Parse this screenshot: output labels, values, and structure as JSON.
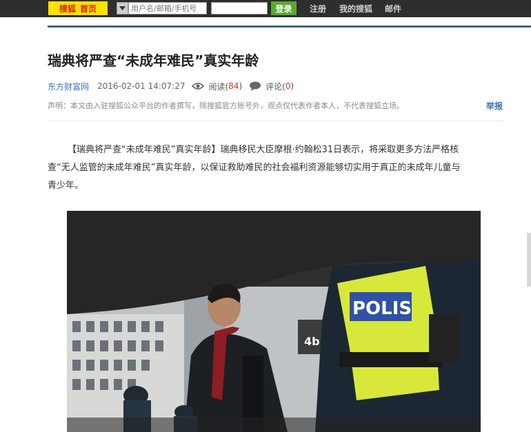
{
  "topbar": {
    "logo_brand": "搜狐",
    "logo_home": "首页",
    "username_placeholder": "用户名/邮箱/手机号",
    "password_value": "",
    "login_label": "登录",
    "links": [
      "注册",
      "我的搜狐",
      "邮件"
    ]
  },
  "article": {
    "title": "瑞典将严查“未成年难民”真实年龄",
    "source": "东方财富网",
    "datetime": "2016-02-01 14:07:27",
    "read_label": "阅读(",
    "read_count": "84",
    "read_close": ")",
    "comment_label": "评论(",
    "comment_count": "0",
    "comment_close": ")",
    "notice": "声明：本文由入驻搜狐公众平台的作者撰写，除搜狐官方账号外，观点仅代表作者本人，不代表搜狐立场。",
    "report_label": "举报",
    "body_lines": [
      "【瑞典将严查“未成年难民”真实年龄】瑞典移民大臣摩根·约翰松31日表示，将采取更多方法严格核",
      "查“无人监管的未成年难民”真实年龄，以保证救助难民的社会福利资源能够切实用于真正的未成年儿童与",
      "青少年。"
    ],
    "photo_texts": {
      "vest": "POLIS",
      "platform_sign": "4b"
    }
  },
  "colors": {
    "topbar_bg": "#2e2e2e",
    "logo_bg": "#ffe100",
    "login_bg": "#58a92f",
    "source_link": "#3a74b5",
    "count_red": "#c0392b",
    "rule": "#45657a"
  },
  "icons": [
    "chevron-down-icon",
    "eye-icon",
    "comment-icon"
  ]
}
